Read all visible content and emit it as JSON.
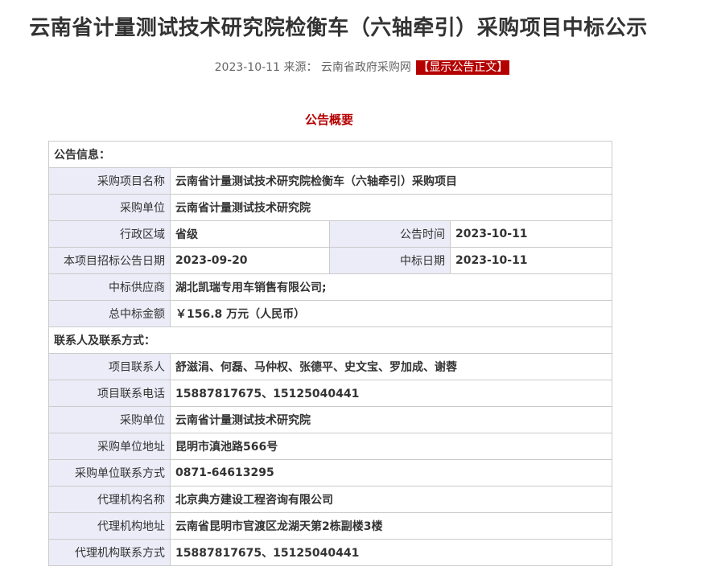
{
  "title": "云南省计量测试技术研究院检衡车（六轴牵引）采购项目中标公示",
  "meta": {
    "date": "2023-10-11",
    "source_label": "来源：",
    "source": "云南省政府采购网",
    "show_button": "【显示公告正文】"
  },
  "summary_title": "公告概要",
  "notice": {
    "group_label": "公告信息：",
    "project_name_label": "采购项目名称",
    "project_name": "云南省计量测试技术研究院检衡车（六轴牵引）采购项目",
    "purchaser_label": "采购单位",
    "purchaser": "云南省计量测试技术研究院",
    "region_label": "行政区域",
    "region": "省级",
    "notice_time_label": "公告时间",
    "notice_time": "2023-10-11",
    "tender_date_label": "本项目招标公告日期",
    "tender_date": "2023-09-20",
    "award_date_label": "中标日期",
    "award_date": "2023-10-11",
    "supplier_label": "中标供应商",
    "supplier": "湖北凯瑞专用车销售有限公司;",
    "amount_label": "总中标金额",
    "amount": "￥156.8 万元（人民币）"
  },
  "contact": {
    "group_label": "联系人及联系方式：",
    "project_contact_label": "项目联系人",
    "project_contact": "舒滋涓、何磊、马仲权、张德平、史文宝、罗加成、谢蓉",
    "project_phone_label": "项目联系电话",
    "project_phone": "15887817675、15125040441",
    "purchaser_label": "采购单位",
    "purchaser": "云南省计量测试技术研究院",
    "purchaser_address_label": "采购单位地址",
    "purchaser_address": "昆明市滇池路566号",
    "purchaser_phone_label": "采购单位联系方式",
    "purchaser_phone": "0871-64613295",
    "agency_label": "代理机构名称",
    "agency": "北京典方建设工程咨询有限公司",
    "agency_address_label": "代理机构地址",
    "agency_address": "云南省昆明市官渡区龙湖天第2栋副楼3楼",
    "agency_phone_label": "代理机构联系方式",
    "agency_phone": "15887817675、15125040441"
  }
}
